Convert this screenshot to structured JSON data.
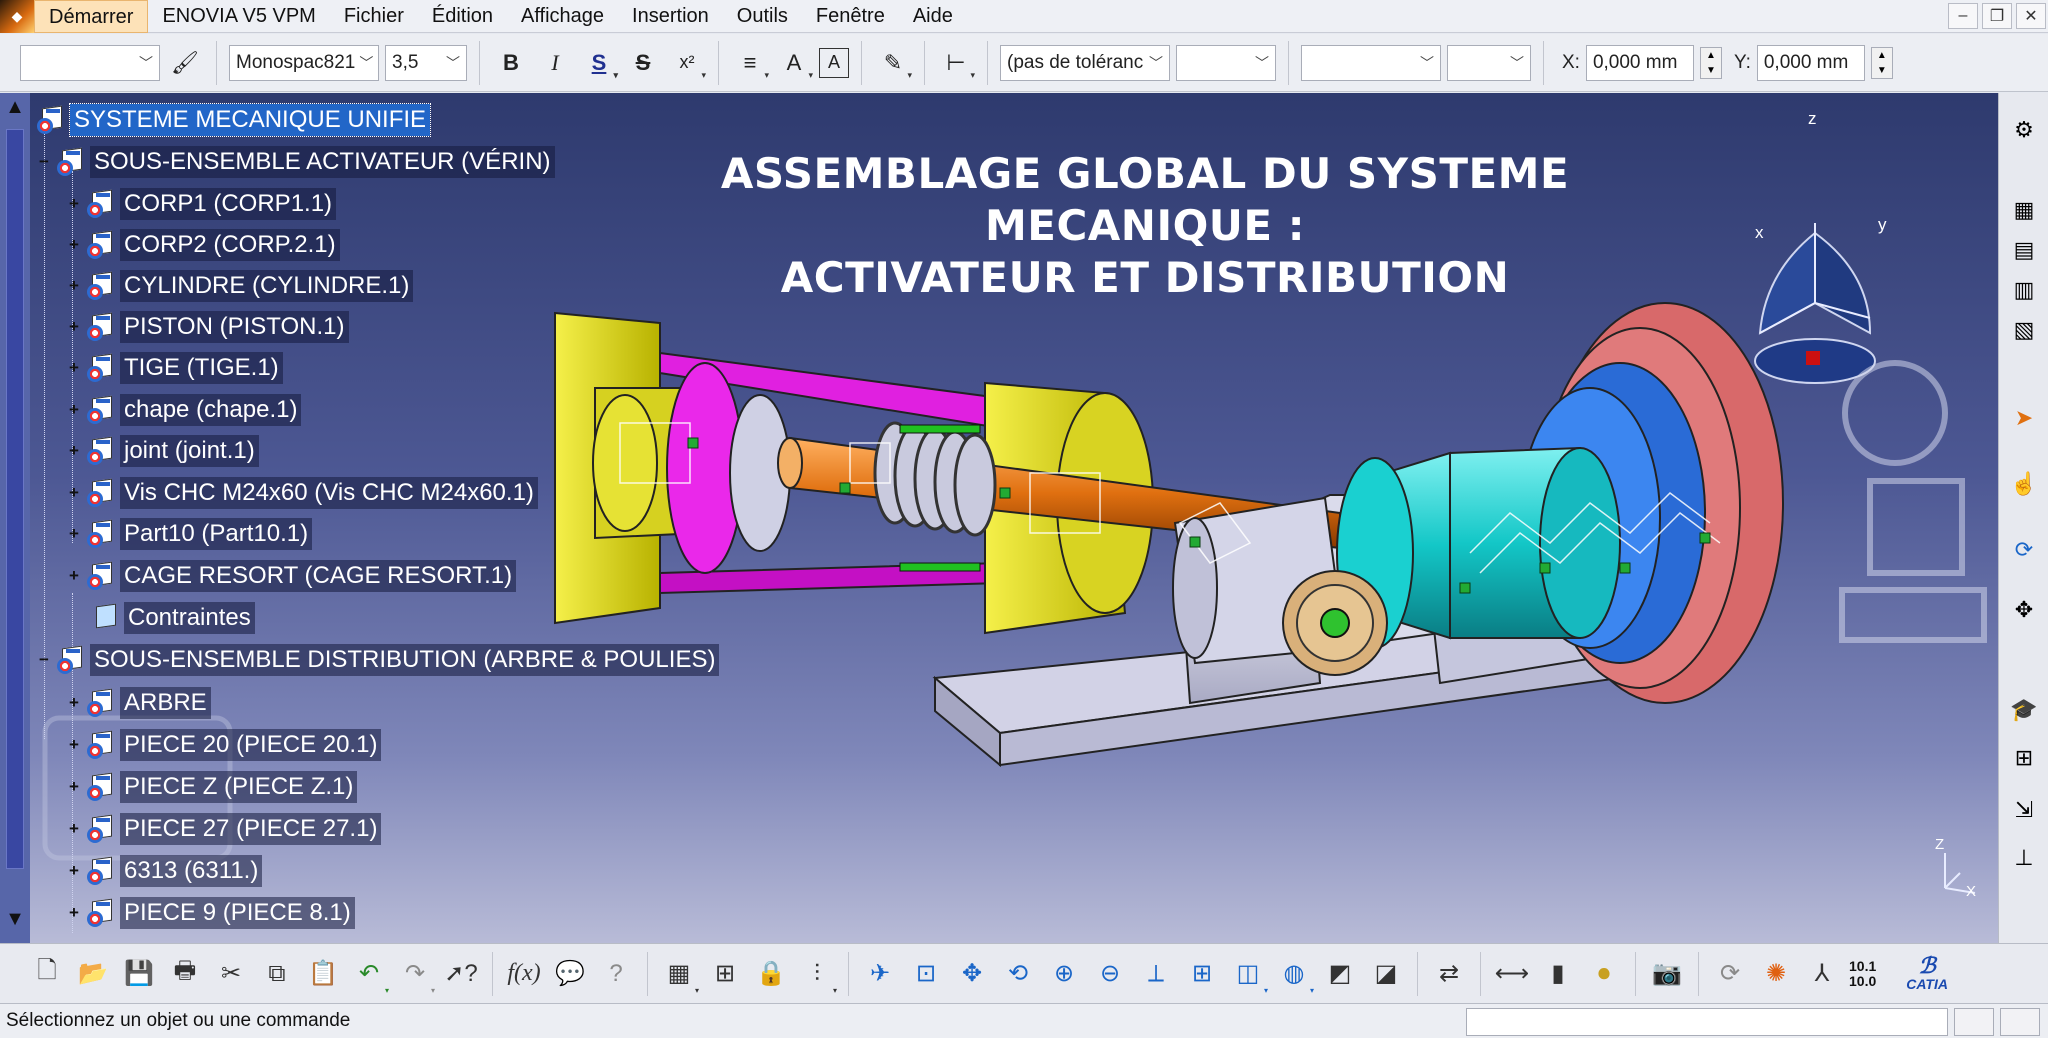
{
  "menubar": {
    "items": [
      "Démarrer",
      "ENOVIA V5 VPM",
      "Fichier",
      "Édition",
      "Affichage",
      "Insertion",
      "Outils",
      "Fenêtre",
      "Aide"
    ]
  },
  "toolbar": {
    "style_value": "",
    "font_value": "Monospac821",
    "size_value": "3,5",
    "tolerance_value": "(pas de toléranc",
    "tolerance2_value": "",
    "blank1_value": "",
    "blank2_value": "",
    "x_label": "X:",
    "x_value": "0,000 mm",
    "y_label": "Y:",
    "y_value": "0,000 mm"
  },
  "tree": {
    "root": "SYSTEME MECANIQUE UNIFIE",
    "group1": "SOUS-ENSEMBLE ACTIVATEUR (VÉRIN)",
    "group1_items": [
      "CORP1 (CORP1.1)",
      "CORP2 (CORP.2.1)",
      "CYLINDRE (CYLINDRE.1)",
      "PISTON (PISTON.1)",
      "TIGE (TIGE.1)",
      "chape (chape.1)",
      "joint (joint.1)",
      "Vis CHC M24x60 (Vis CHC M24x60.1)",
      "Part10 (Part10.1)",
      "CAGE RESORT (CAGE RESORT.1)"
    ],
    "constraints": "Contraintes",
    "group2": "SOUS-ENSEMBLE DISTRIBUTION (ARBRE & POULIES)",
    "group2_items": [
      "ARBRE",
      "PIECE 20 (PIECE 20.1)",
      "PIECE Z (PIECE Z.1)",
      "PIECE 27 (PIECE 27.1)",
      "6313 (6311.)",
      "PIECE 9 (PIECE 8.1)"
    ]
  },
  "viewport": {
    "title_line1": "ASSEMBLAGE GLOBAL DU SYSTEME MECANIQUE :",
    "title_line2": "ACTIVATEUR ET DISTRIBUTION",
    "compass_z": "z",
    "compass_x": "x",
    "compass_y": "y",
    "axis_z": "Z",
    "axis_x": "X"
  },
  "bottombar": {
    "zoom_top": "10.1",
    "zoom_bottom": "10.0",
    "brand": "CATIA"
  },
  "status": {
    "message": "Sélectionnez un objet ou une commande"
  }
}
